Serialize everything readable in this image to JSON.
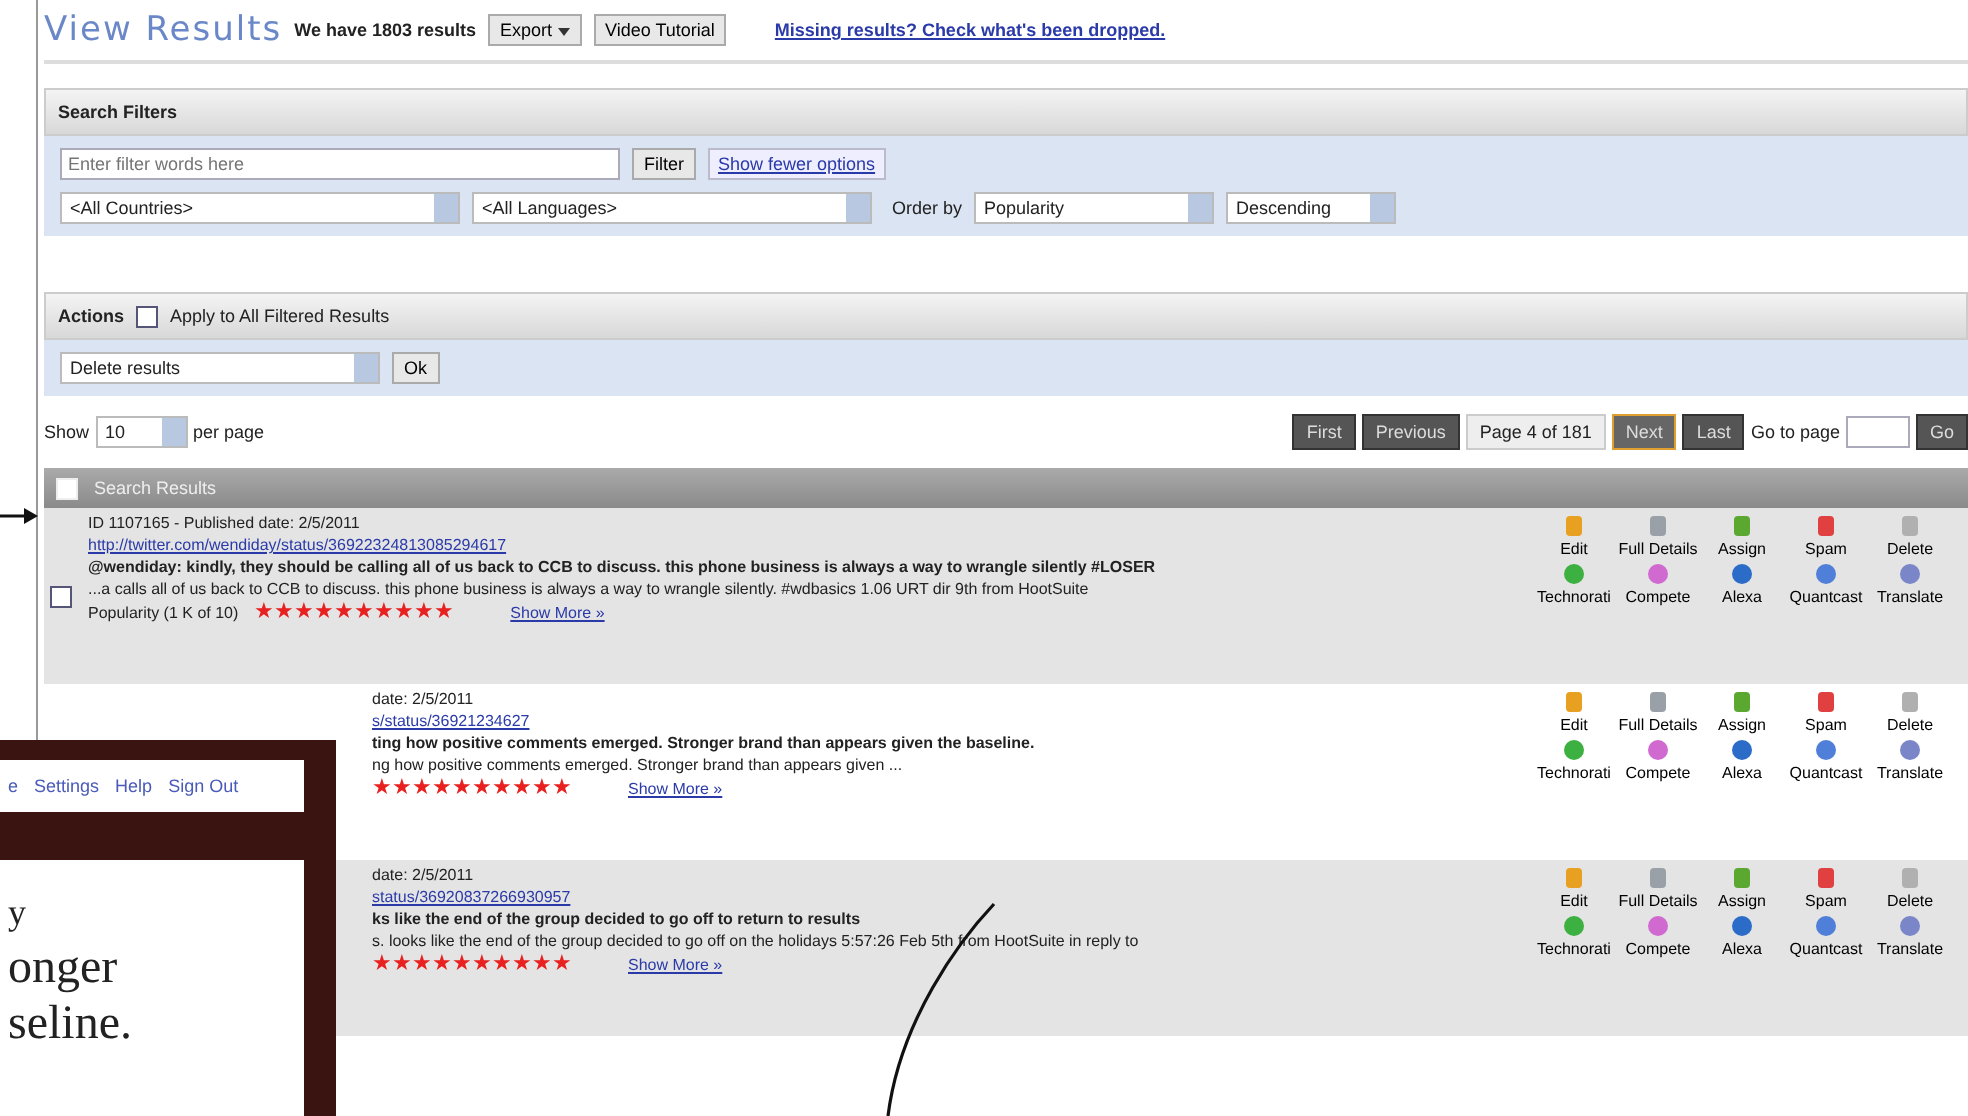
{
  "header": {
    "title": "View Results",
    "count": "We have 1803 results",
    "export": "Export",
    "tutorial": "Video Tutorial",
    "missing_link": "Missing results? Check what's been dropped."
  },
  "filters": {
    "title": "Search Filters",
    "placeholder": "Enter filter words here",
    "filter_button": "Filter",
    "options_link": "Show fewer options",
    "country": "<All Countries>",
    "language": "<All Languages>",
    "order_label": "Order by",
    "order": "Popularity",
    "direction": "Descending"
  },
  "actions_panel": {
    "title": "Actions",
    "apply_all": {
      "label": "Apply to All Filtered Results",
      "checked": false
    },
    "action": "Delete results",
    "ok": "Ok"
  },
  "paging": {
    "show": "Show",
    "per_page": "10",
    "per_page_label": "per page",
    "buttons": [
      {
        "label": "First",
        "selected": false
      },
      {
        "label": "Previous",
        "selected": false
      },
      {
        "label": "Next",
        "selected": true
      },
      {
        "label": "Last",
        "selected": false
      }
    ],
    "page_info": "Page 4 of 181",
    "goto_label": "Go to page",
    "go": "Go"
  },
  "results": {
    "title": "Search Results",
    "select_all": {
      "checked": false
    },
    "rows": [
      {
        "meta": "ID 1107165 - Published date: 2/5/2011",
        "url": "http://twitter.com/wendiday/status/36922324813085294617",
        "title": "@wendiday: kindly, they should be calling all of us back to CCB to discuss. this phone business is always a way to wrangle silently #LOSER",
        "snippet": "...a calls all of us back to CCB to discuss. this phone business is always a way to wrangle silently. #wdbasics 1.06 URT dir 9th from HootSuite",
        "popularity": "Popularity (1 K of 10)",
        "stars": 10,
        "more": "Show More »",
        "checked": false,
        "actions": [
          "Edit",
          "Full Details",
          "Assign",
          "Spam",
          "Delete"
        ],
        "sites": [
          "Technorati",
          "Compete",
          "Alexa",
          "Quantcast",
          "Translate"
        ]
      },
      {
        "meta": "date: 2/5/2011",
        "url": "s/status/36921234627",
        "title": "ting how positive comments emerged. Stronger brand than appears given the baseline.",
        "snippet": "ng how positive comments emerged. Stronger brand than appears given ...",
        "stars": 10,
        "more": "Show More »",
        "actions": [
          "Edit",
          "Full Details",
          "Assign",
          "Spam",
          "Delete"
        ],
        "sites": [
          "Technorati",
          "Compete",
          "Alexa",
          "Quantcast",
          "Translate"
        ]
      },
      {
        "meta": "date: 2/5/2011",
        "url": "status/36920837266930957",
        "title": "ks like the end of the group decided to go off to return to results",
        "snippet": "s. looks like the end of the group decided to go off on the holidays 5:57:26 Feb 5th from HootSuite in reply to",
        "stars": 10,
        "more": "Show More »",
        "actions": [
          "Edit",
          "Full Details",
          "Assign",
          "Spam",
          "Delete"
        ],
        "sites": [
          "Technorati",
          "Compete",
          "Alexa",
          "Quantcast",
          "Translate"
        ]
      }
    ]
  },
  "inset": {
    "links": [
      "e",
      "Settings",
      "Help",
      "Sign Out"
    ],
    "lines": [
      "y",
      "onger",
      "seline."
    ]
  }
}
